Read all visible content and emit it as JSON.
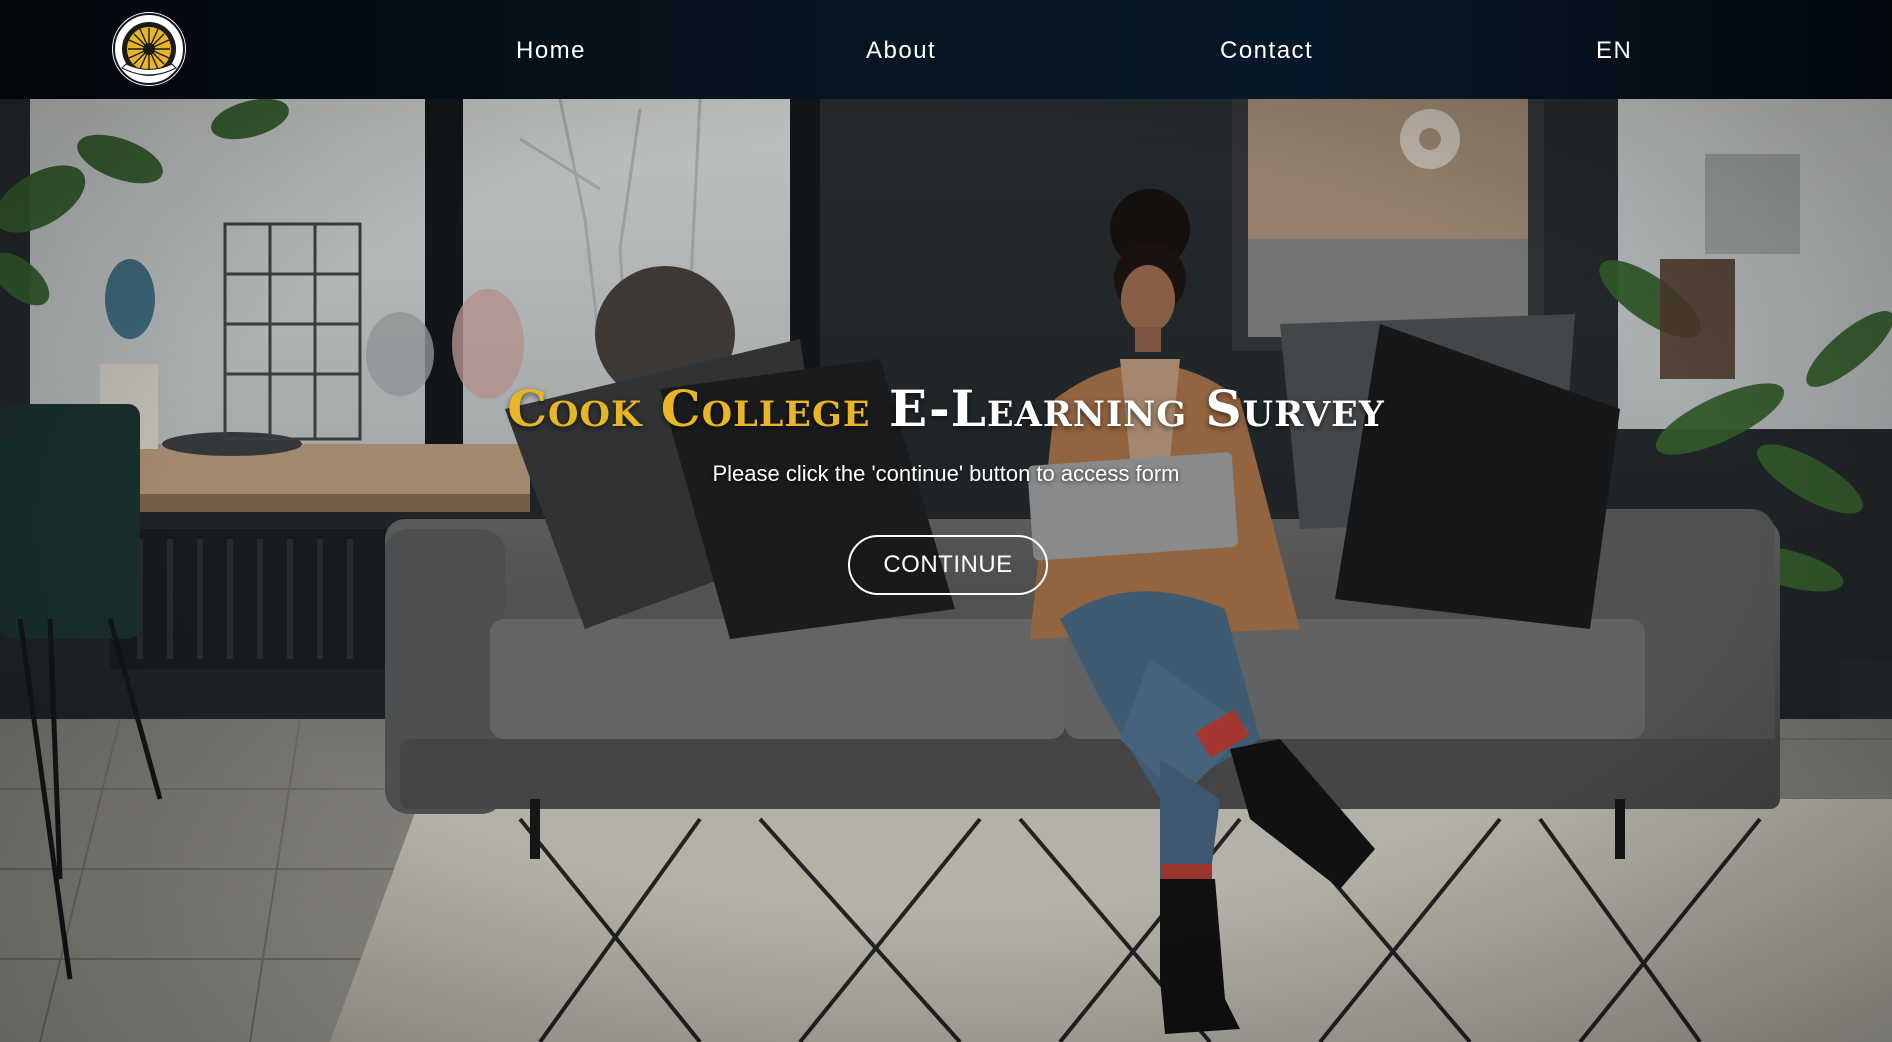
{
  "brand": {
    "logo_icon": "cook-college-seal-icon",
    "logo_text_top": "COOK COLLEGE",
    "colors": {
      "accent": "#e8b526",
      "nav_bg": "#061521",
      "text": "#ffffff"
    }
  },
  "nav": {
    "home": "Home",
    "about": "About",
    "contact": "Contact",
    "language": "EN"
  },
  "hero": {
    "title_accent": "Cook College",
    "title_main": "E-Learning Survey",
    "subtitle": "Please click the 'continue' button to access form",
    "continue_label": "CONTINUE"
  }
}
